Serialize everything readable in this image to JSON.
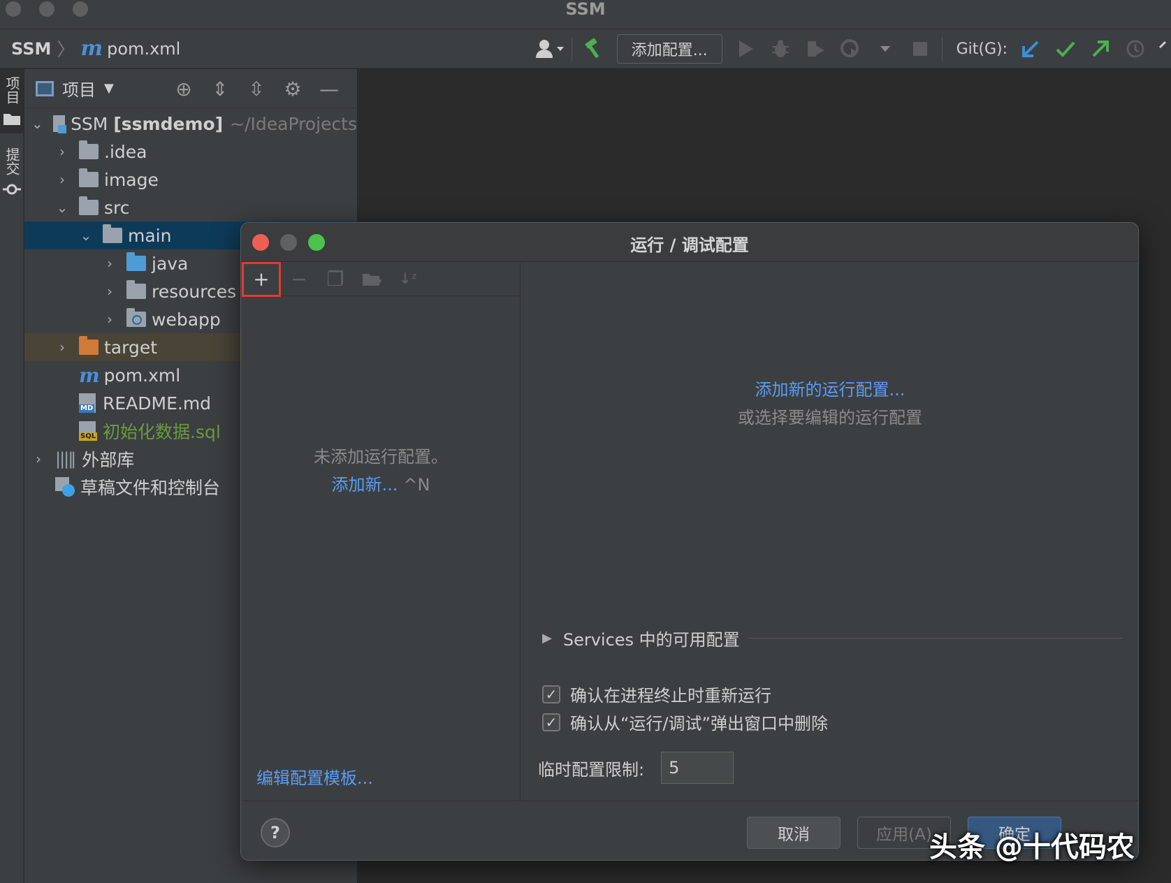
{
  "window": {
    "title": "SSM"
  },
  "navbar": {
    "project": "SSM",
    "separator": "〉",
    "maven_glyph": "m",
    "file": "pom.xml",
    "add_config_label": "添加配置...",
    "git_label": "Git(G):"
  },
  "toolstrip": {
    "project_tab": "项目",
    "commit_tab": "提交"
  },
  "project_panel": {
    "title": "项目",
    "tree": {
      "root_name": "SSM",
      "root_module": "[ssmdemo]",
      "root_path": "~/IdeaProjects",
      "idea": ".idea",
      "image": "image",
      "src": "src",
      "main": "main",
      "java": "java",
      "resources": "resources",
      "webapp": "webapp",
      "target": "target",
      "pom_glyph": "m",
      "pom": "pom.xml",
      "readme": "README.md",
      "readme_tag": "MD",
      "sql": "初始化数据.sql",
      "sql_tag": "SQL",
      "external_libs": "外部库",
      "scratches": "草稿文件和控制台"
    }
  },
  "dialog": {
    "title": "运行 / 调试配置",
    "left": {
      "empty_message": "未添加运行配置。",
      "add_new_link": "添加新...",
      "add_new_shortcut": "^N",
      "edit_templates_link": "编辑配置模板..."
    },
    "right": {
      "add_config_link": "添加新的运行配置...",
      "select_hint": "或选择要编辑的运行配置",
      "services_label": "Services 中的可用配置",
      "confirm_rerun_label": "确认在进程终止时重新运行",
      "confirm_rerun_checked": true,
      "confirm_delete_label": "确认从“运行/调试”弹出窗口中删除",
      "confirm_delete_checked": true,
      "temp_limit_label": "临时配置限制:",
      "temp_limit_value": "5"
    },
    "footer": {
      "help": "?",
      "cancel": "取消",
      "apply": "应用(A)",
      "ok": "确定"
    }
  },
  "watermark": "头条 @十代码农"
}
